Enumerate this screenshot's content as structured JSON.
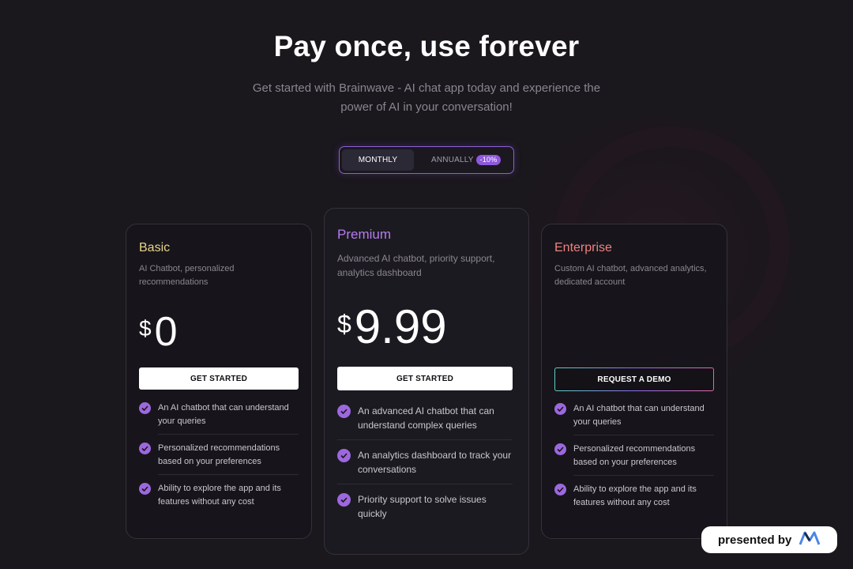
{
  "header": {
    "title": "Pay once, use forever",
    "subtitle": "Get started with Brainwave - AI chat app today and experience the power of AI in your conversation!"
  },
  "billing_toggle": {
    "monthly_label": "MONTHLY",
    "annually_label": "ANNUALLY",
    "annually_badge": "-10%",
    "selected": "MONTHLY"
  },
  "plans": [
    {
      "name": "Basic",
      "description": "AI Chatbot, personalized recommendations",
      "currency": "$",
      "price": "0",
      "button_label": "GET STARTED",
      "features": [
        "An AI chatbot that can understand your queries",
        "Personalized recommendations based on your preferences",
        "Ability to explore the app and its features without any cost"
      ]
    },
    {
      "name": "Premium",
      "description": "Advanced AI chatbot, priority support, analytics dashboard",
      "currency": "$",
      "price": "9.99",
      "button_label": "GET STARTED",
      "features": [
        "An advanced AI chatbot that can understand complex queries",
        "An analytics dashboard to track your conversations",
        "Priority support to solve issues quickly"
      ]
    },
    {
      "name": "Enterprise",
      "description": "Custom AI chatbot, advanced analytics, dedicated account",
      "button_label": "REQUEST A DEMO",
      "features": [
        "An AI chatbot that can understand your queries",
        "Personalized recommendations based on your preferences",
        "Ability to explore the app and its features without any cost"
      ]
    }
  ],
  "footer_badge": {
    "label": "presented by",
    "logo_icon": "brand-m-logo-icon"
  },
  "colors": {
    "background": "#1a171d",
    "accent_purple": "#8f59de",
    "basic_name": "#e9d38c",
    "premium_name": "#b57cf0",
    "enterprise_name": "#f0827e"
  }
}
